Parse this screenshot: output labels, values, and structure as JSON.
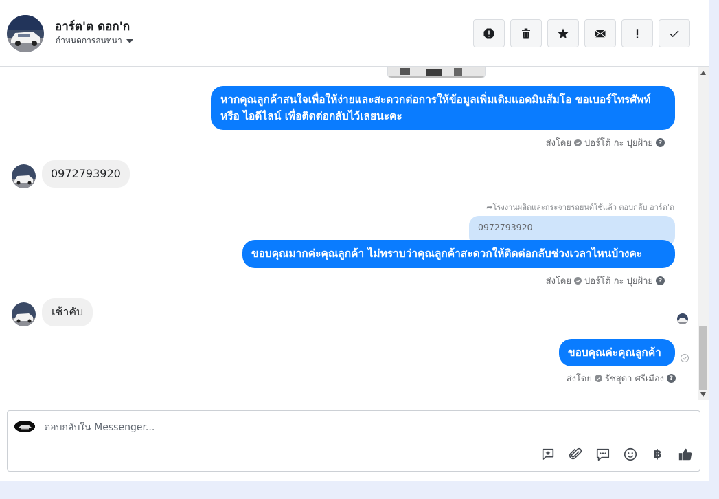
{
  "header": {
    "name": "อาร์ต'ต ดอก'ก",
    "assign_label": "กำหนดการสนทนา"
  },
  "messages": {
    "m1": {
      "text": "หากคุณลูกค้าสนใจเพื่อให้ง่ายและสะดวกต่อการให้ข้อมูลเพิ่มเติมแอดมินส้มโอ ขอเบอร์โทรศัพท์ หรือ ไอดีไลน์ เพื่อติดต่อกลับไว้เลยนะคะ",
      "sent_by_label": "ส่งโดย",
      "sender": "ปอร์โต้ กะ ปุยฝ้าย"
    },
    "m2": {
      "text": "0972793920"
    },
    "m3": {
      "reply_note": "โรงงานผลิตและกระจายรถยนต์ใช้แล้ว ตอบกลับ อาร์ต'ต",
      "quoted": "0972793920",
      "text": "ขอบคุณมากค่ะคุณลูกค้า ไม่ทราบว่าคุณลูกค้าสะดวกให้ติดต่อกลับช่วงเวลาไหนบ้างคะ",
      "sent_by_label": "ส่งโดย",
      "sender": "ปอร์โต้ กะ ปุยฝ้าย"
    },
    "m4": {
      "text": "เช้าคับ"
    },
    "m5": {
      "text": "ขอบคุณค่ะคุณลูกค้า",
      "sent_by_label": "ส่งโดย",
      "sender": "รัชสุดา ศรีเมือง"
    }
  },
  "composer": {
    "placeholder": "ตอบกลับใน Messenger...",
    "currency_symbol": "฿"
  },
  "colors": {
    "accent": "#0a7cff",
    "incoming_bubble": "#f0f0f0",
    "quoted_bubble": "#cfe4fb"
  }
}
